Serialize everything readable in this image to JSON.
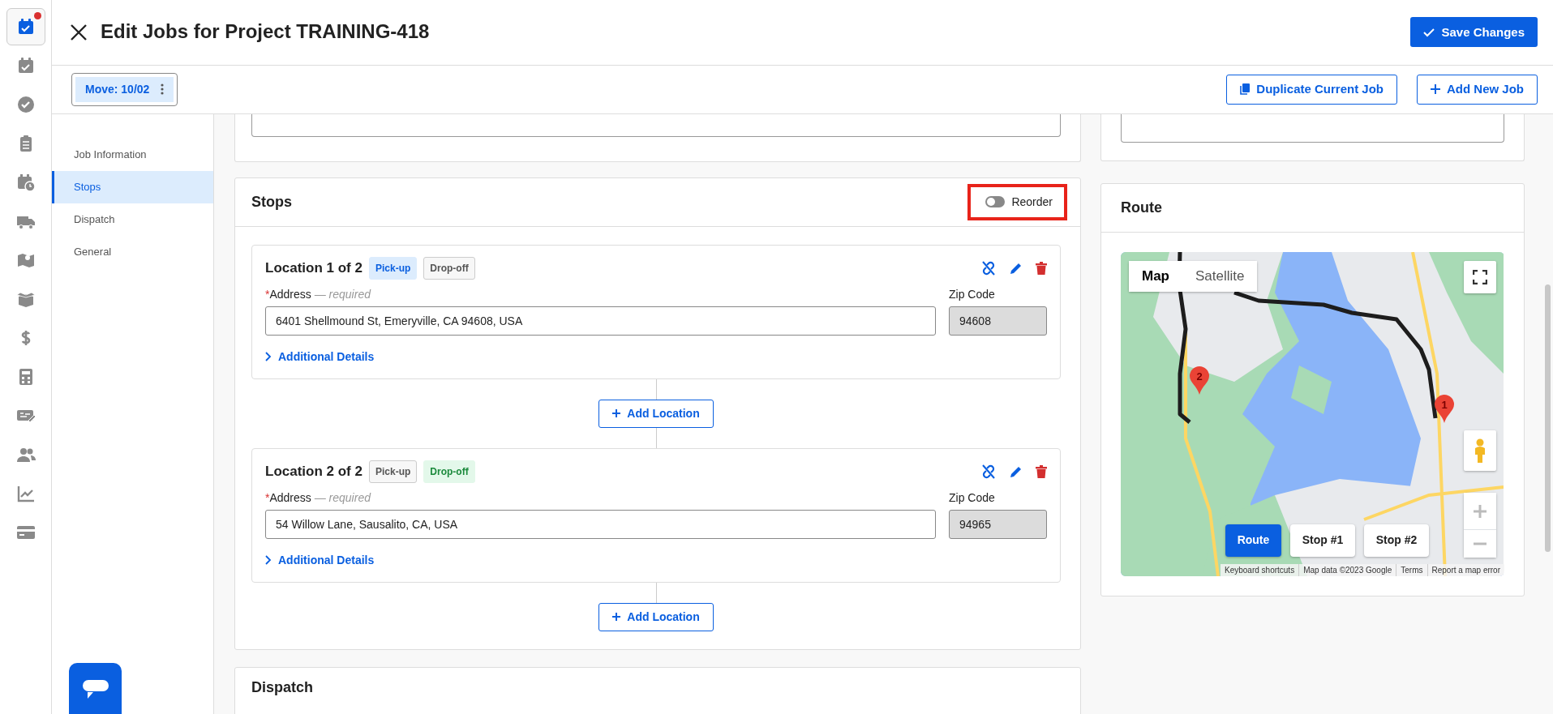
{
  "rail": [
    {
      "kind": "calendar-check",
      "selected": true,
      "badge": true
    },
    {
      "kind": "calendar-check",
      "selected": false,
      "badge": false
    },
    {
      "kind": "check-circle",
      "selected": false,
      "badge": false
    },
    {
      "kind": "clipboard",
      "selected": false,
      "badge": false
    },
    {
      "kind": "calendar-clock",
      "selected": false,
      "badge": false
    },
    {
      "kind": "truck",
      "selected": false,
      "badge": false
    },
    {
      "kind": "map",
      "selected": false,
      "badge": false
    },
    {
      "kind": "box",
      "selected": false,
      "badge": false
    },
    {
      "kind": "dollar",
      "selected": false,
      "badge": false
    },
    {
      "kind": "calculator",
      "selected": false,
      "badge": false
    },
    {
      "kind": "cheque",
      "selected": false,
      "badge": false
    },
    {
      "kind": "users",
      "selected": false,
      "badge": false
    },
    {
      "kind": "chart",
      "selected": false,
      "badge": false
    },
    {
      "kind": "card",
      "selected": false,
      "badge": false
    }
  ],
  "header": {
    "title": "Edit Jobs for Project TRAINING-418",
    "save_button": "Save Changes"
  },
  "job_tabs": [
    {
      "label": "Move: 10/02",
      "selected": true
    }
  ],
  "toolbar_buttons": [
    {
      "kind": "duplicate",
      "label": "Duplicate Current Job"
    },
    {
      "kind": "add",
      "label": "Add New Job"
    }
  ],
  "section_nav": [
    {
      "label": "Job Information",
      "selected": false
    },
    {
      "label": "Stops",
      "selected": true
    },
    {
      "label": "Dispatch",
      "selected": false
    },
    {
      "label": "General",
      "selected": false
    }
  ],
  "stops": {
    "title": "Stops",
    "reorder": {
      "label": "Reorder",
      "on": false,
      "highlighted": true
    },
    "locations": [
      {
        "title": "Location 1 of 2",
        "tags": [
          {
            "kind": "pickup",
            "label": "Pick-up",
            "selected": true
          },
          {
            "kind": "dropoff",
            "label": "Drop-off",
            "selected": false
          }
        ],
        "required_mark": "*",
        "address_label": "Address",
        "required_note": "— required",
        "address": "6401 Shellmound St, Emeryville, CA 94608, USA",
        "zip_label": "Zip Code",
        "zip": "94608",
        "details_link": "Additional Details",
        "add_button": "Add Location"
      },
      {
        "title": "Location 2 of 2",
        "tags": [
          {
            "kind": "pickup",
            "label": "Pick-up",
            "selected": false
          },
          {
            "kind": "dropoff",
            "label": "Drop-off",
            "selected": true
          }
        ],
        "required_mark": "*",
        "address_label": "Address",
        "required_note": "— required",
        "address": "54 Willow Lane, Sausalito, CA, USA",
        "zip_label": "Zip Code",
        "zip": "94965",
        "details_link": "Additional Details",
        "add_button": "Add Location"
      }
    ]
  },
  "dispatch": {
    "title": "Dispatch"
  },
  "route": {
    "title": "Route",
    "map": {
      "kind": "picture",
      "map_types": [
        {
          "label": "Map",
          "selected": true
        },
        {
          "label": "Satellite",
          "selected": false
        }
      ],
      "pins": [
        {
          "label": "1"
        },
        {
          "label": "2"
        }
      ],
      "views": [
        {
          "label": "Route",
          "selected": true
        },
        {
          "label": "Stop #1",
          "selected": false
        },
        {
          "label": "Stop #2",
          "selected": false
        }
      ],
      "attribution": [
        "Keyboard shortcuts",
        "Map data ©2023 Google",
        "Terms",
        "Report a map error"
      ]
    }
  }
}
